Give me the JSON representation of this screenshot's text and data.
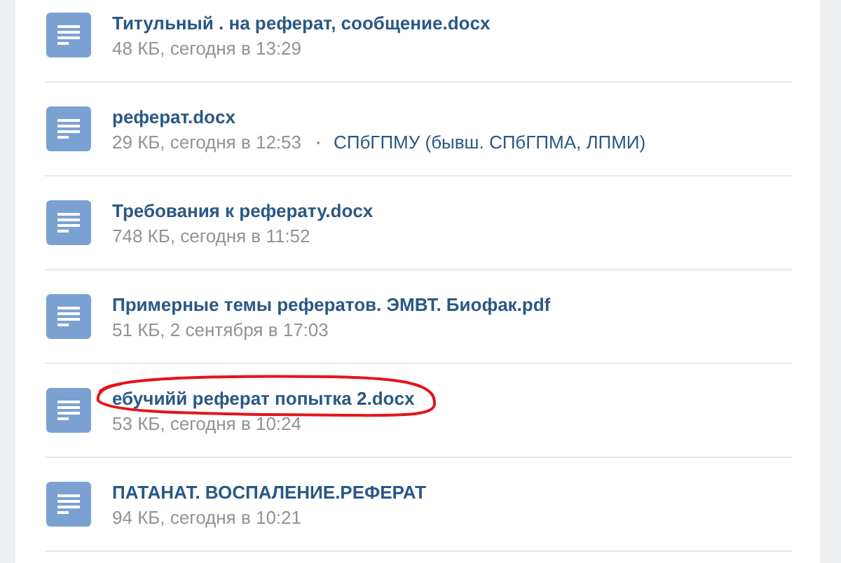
{
  "documents": [
    {
      "title": "Титульный . на реферат, сообщение.docx",
      "meta": "48 КБ, сегодня в 13:29",
      "circled": false
    },
    {
      "title": "реферат.docx",
      "meta": "29 КБ, сегодня в 12:53",
      "source": "СПбГПМУ (бывш. СПбГПМА, ЛПМИ)",
      "circled": false
    },
    {
      "title": "Требования к реферату.docx",
      "meta": "748 КБ, сегодня в 11:52",
      "circled": false
    },
    {
      "title": "Примерные темы рефератов. ЭМВТ. Биофак.pdf",
      "meta": "51 КБ, 2 сентября в 17:03",
      "circled": false
    },
    {
      "title": "ебучийй реферат попытка 2.docx",
      "meta": "53 КБ, сегодня в 10:24",
      "circled": true
    },
    {
      "title": "ПАТАНАТ. ВОСПАЛЕНИЕ.РЕФЕРАТ",
      "meta": "94 КБ, сегодня в 10:21",
      "circled": false
    }
  ]
}
